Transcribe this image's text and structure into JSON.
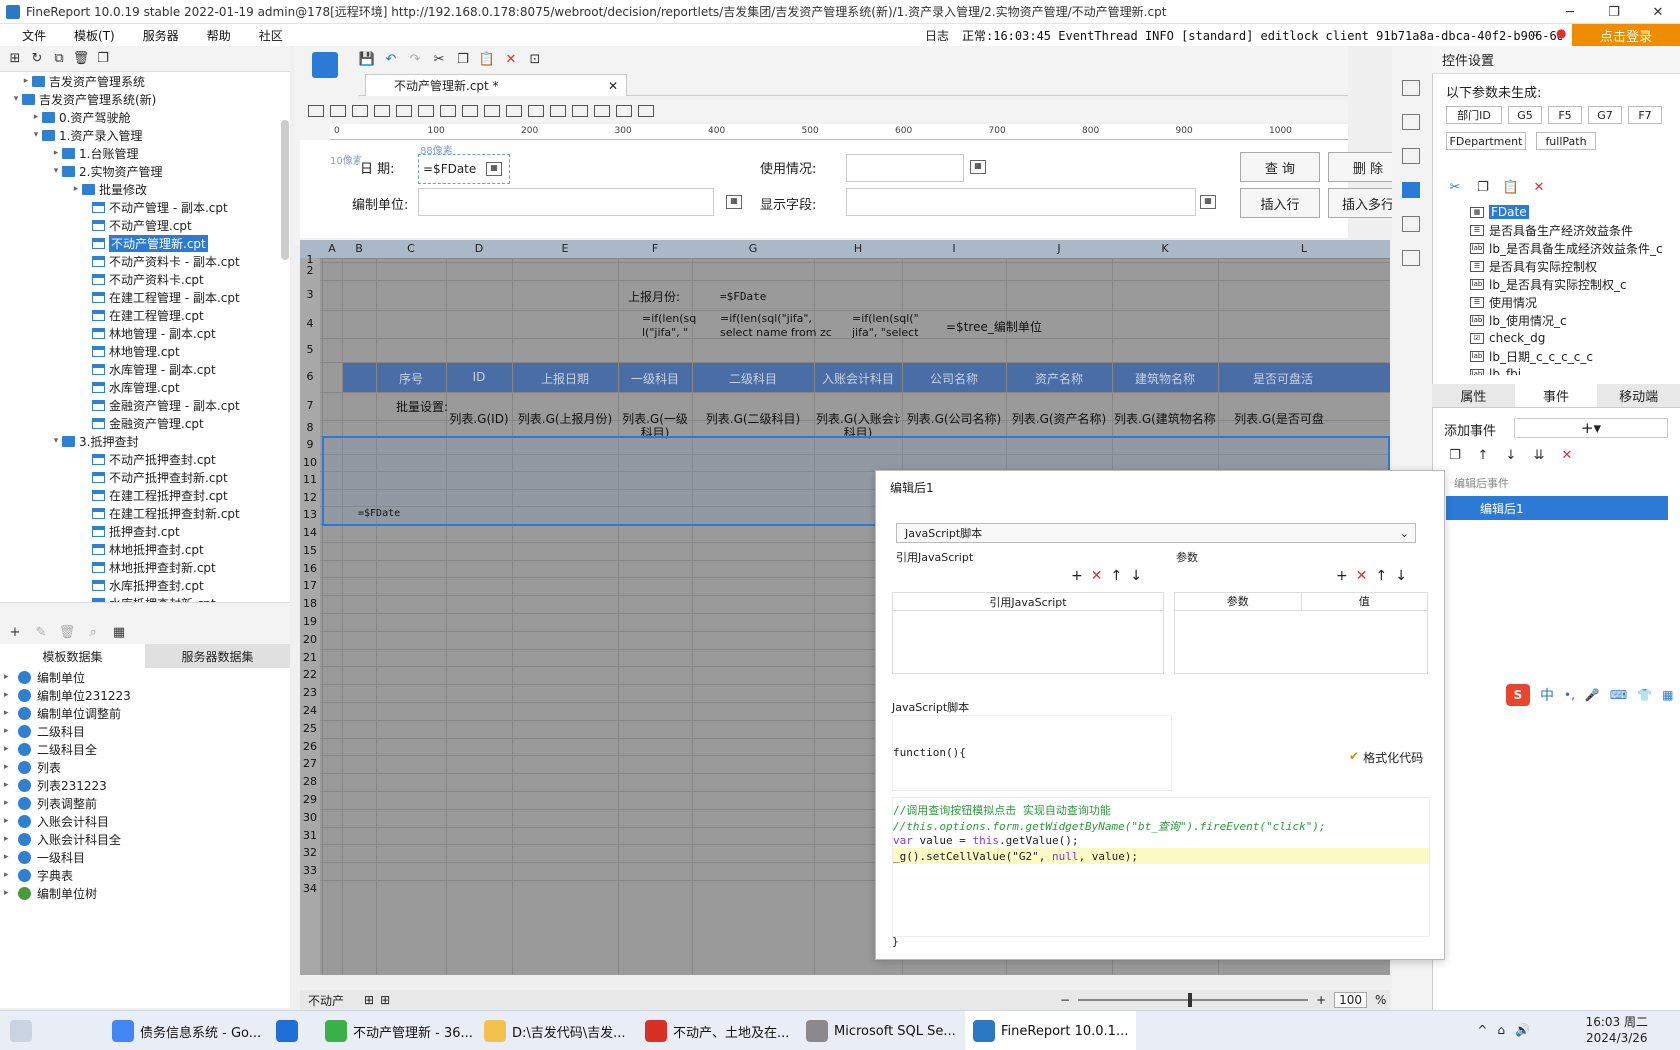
{
  "window": {
    "title": "FineReport 10.0.19 stable 2022-01-19 admin@178[远程环境]   http://192.168.0.178:8075/webroot/decision/reportlets/吉发集团/吉发资产管理系统(新)/1.资产录入管理/2.实物资产管理/不动产管理新.cpt",
    "controls": [
      "─",
      "❐",
      "✕"
    ]
  },
  "menu": {
    "items": [
      "文件",
      "模板(T)",
      "服务器",
      "帮助",
      "社区"
    ],
    "log_label": "日志",
    "log_text": "正常:16:03:45 EventThread INFO [standard] editlock client 91b71a8a-dbca-40f2-b906-68f6f8b4...",
    "login": "点击登录"
  },
  "tree": {
    "rows": [
      {
        "text": "吉发资产管理系统",
        "indent": 2,
        "type": "folder",
        "toggle": "▸"
      },
      {
        "text": "吉发资产管理系统(新)",
        "indent": 1,
        "type": "folder",
        "toggle": "▾"
      },
      {
        "text": "0.资产驾驶舱",
        "indent": 3,
        "type": "folder",
        "toggle": "▸"
      },
      {
        "text": "1.资产录入管理",
        "indent": 3,
        "type": "folder",
        "toggle": "▾"
      },
      {
        "text": "1.台账管理",
        "indent": 5,
        "type": "folder",
        "toggle": "▸"
      },
      {
        "text": "2.实物资产管理",
        "indent": 5,
        "type": "folder",
        "toggle": "▾"
      },
      {
        "text": "批量修改",
        "indent": 7,
        "type": "folder",
        "toggle": "▸"
      },
      {
        "text": "不动产管理 - 副本.cpt",
        "indent": 8,
        "type": "file",
        "toggle": ""
      },
      {
        "text": "不动产管理.cpt",
        "indent": 8,
        "type": "file",
        "toggle": ""
      },
      {
        "text": "不动产管理新.cpt",
        "indent": 8,
        "type": "file",
        "toggle": "",
        "selected": true
      },
      {
        "text": "不动产资料卡 - 副本.cpt",
        "indent": 8,
        "type": "file",
        "toggle": ""
      },
      {
        "text": "不动产资料卡.cpt",
        "indent": 8,
        "type": "file",
        "toggle": ""
      },
      {
        "text": "在建工程管理 - 副本.cpt",
        "indent": 8,
        "type": "file",
        "toggle": ""
      },
      {
        "text": "在建工程管理.cpt",
        "indent": 8,
        "type": "file",
        "toggle": ""
      },
      {
        "text": "林地管理 - 副本.cpt",
        "indent": 8,
        "type": "file",
        "toggle": ""
      },
      {
        "text": "林地管理.cpt",
        "indent": 8,
        "type": "file",
        "toggle": ""
      },
      {
        "text": "水库管理 - 副本.cpt",
        "indent": 8,
        "type": "file",
        "toggle": ""
      },
      {
        "text": "水库管理.cpt",
        "indent": 8,
        "type": "file",
        "toggle": ""
      },
      {
        "text": "金融资产管理 - 副本.cpt",
        "indent": 8,
        "type": "file",
        "toggle": ""
      },
      {
        "text": "金融资产管理.cpt",
        "indent": 8,
        "type": "file",
        "toggle": ""
      },
      {
        "text": "3.抵押查封",
        "indent": 5,
        "type": "folder",
        "toggle": "▾"
      },
      {
        "text": "不动产抵押查封.cpt",
        "indent": 8,
        "type": "file",
        "toggle": ""
      },
      {
        "text": "不动产抵押查封新.cpt",
        "indent": 8,
        "type": "file",
        "toggle": ""
      },
      {
        "text": "在建工程抵押查封.cpt",
        "indent": 8,
        "type": "file",
        "toggle": ""
      },
      {
        "text": "在建工程抵押查封新.cpt",
        "indent": 8,
        "type": "file",
        "toggle": ""
      },
      {
        "text": "抵押查封.cpt",
        "indent": 8,
        "type": "file",
        "toggle": ""
      },
      {
        "text": "林地抵押查封.cpt",
        "indent": 8,
        "type": "file",
        "toggle": ""
      },
      {
        "text": "林地抵押查封新.cpt",
        "indent": 8,
        "type": "file",
        "toggle": ""
      },
      {
        "text": "水库抵押查封.cpt",
        "indent": 8,
        "type": "file",
        "toggle": ""
      },
      {
        "text": "水库抵押查封新.cpt",
        "indent": 8,
        "type": "file",
        "toggle": ""
      }
    ]
  },
  "datasets": {
    "tab_template": "模板数据集",
    "tab_server": "服务器数据集",
    "items": [
      "编制单位",
      "编制单位231223",
      "编制单位调整前",
      "二级科目",
      "二级科目全",
      "列表",
      "列表231223",
      "列表调整前",
      "入账会计科目",
      "入账会计科目全",
      "一级科目",
      "字典表",
      "编制单位树"
    ]
  },
  "doc": {
    "tab_name": "不动产管理新.cpt *"
  },
  "ruler": [
    "0",
    "100",
    "200",
    "300",
    "400",
    "500",
    "600",
    "700",
    "800",
    "900",
    "1000"
  ],
  "params": {
    "hint_top": "88像素",
    "hint_left": "10像素",
    "date_label": "日 期:",
    "date_value": "=$FDate",
    "unit_label": "编制单位:",
    "usage_label": "使用情况:",
    "field_label": "显示字段:",
    "btn_query": "查 询",
    "btn_delete": "删 除",
    "btn_insert": "插入行",
    "btn_insert_multi": "插入多行"
  },
  "sheet": {
    "columns": [
      "A",
      "B",
      "C",
      "D",
      "E",
      "F",
      "G",
      "H",
      "I",
      "J",
      "K",
      "L"
    ],
    "rows": [
      "1",
      "2",
      "3",
      "4",
      "5",
      "6",
      "7",
      "8",
      "9",
      "10",
      "11",
      "12",
      "13",
      "14",
      "15",
      "16",
      "17",
      "18",
      "19",
      "20",
      "21",
      "22",
      "23",
      "24",
      "25",
      "26",
      "27",
      "28",
      "29",
      "30",
      "31",
      "32",
      "33",
      "34"
    ],
    "cells": {
      "f2": "上报月份:",
      "g2": "=$FDate",
      "f3": "=if(len(sq\nl(\"jifa\", \"",
      "g3": "=if(len(sql(\"jifa\",\nselect name from zc",
      "h3": "=if(len(sql(\"\njifa\", \"select",
      "i3": "=$tree_编制单位",
      "batch": "批量设置:",
      "c10": "=$FDate"
    },
    "header_row": [
      "序号",
      "ID",
      "上报日期",
      "一级科目",
      "二级科目",
      "入账会计科目",
      "公司名称",
      "资产名称",
      "建筑物名称",
      "是否可盘活"
    ],
    "row7": [
      "列表.G(ID)",
      "列表.G(上报月份)",
      "列表.G(一级\n科目)",
      "列表.G(二级科目)",
      "列表.G(入账会计\n科目)",
      "列表.G(公司名称)",
      "列表.G(资产名称)",
      "列表.G(建筑物名称)",
      "列表.G(是否可盘"
    ],
    "sheet_tab": "不动产",
    "zoom": "100",
    "zoom_unit": "%"
  },
  "right_panel": {
    "title": "控件设置",
    "notice": "以下参数未生成:",
    "params": [
      "部门ID",
      "G5",
      "F5",
      "G7",
      "F7",
      "FDepartment",
      "fullPath"
    ],
    "widgets": [
      {
        "name": "FDate",
        "icon": "cal",
        "selected": true
      },
      {
        "name": "是否具备生产经济效益条件",
        "icon": "combo"
      },
      {
        "name": "lb_是否具备生成经济效益条件_c",
        "icon": "lab"
      },
      {
        "name": "是否具有实际控制权",
        "icon": "combo"
      },
      {
        "name": "lb_是否具有实际控制权_c",
        "icon": "lab"
      },
      {
        "name": "使用情况",
        "icon": "combo"
      },
      {
        "name": "lb_使用情况_c",
        "icon": "lab"
      },
      {
        "name": "check_dg",
        "icon": "chk"
      },
      {
        "name": "lb_日期_c_c_c_c_c",
        "icon": "lab"
      },
      {
        "name": "lb_fbi...",
        "icon": "lab"
      }
    ],
    "tabs": [
      "属性",
      "事件",
      "移动端"
    ],
    "add_event": "添加事件",
    "event_section": "编辑后事件",
    "event_item": "编辑后1"
  },
  "dialog": {
    "title": "编辑后1",
    "type": "JavaScript脚本",
    "ref_js": "引用JavaScript",
    "params_label": "参数",
    "ref_js_col": "引用JavaScript",
    "param_col": "参数",
    "value_col": "值",
    "script_label": "JavaScript脚本",
    "fn_head": "function(){",
    "format_btn": "格式化代码",
    "code_line1": "//调用查询按钮模拟点击 实现自动查询功能",
    "code_line2": "//this.options.form.getWidgetByName(\"bt_查询\").fireEvent(\"click\");",
    "code_line3a": "var",
    "code_line3b": " value = ",
    "code_line3c": "this",
    "code_line3d": ".getValue();",
    "code_line4a": "_g().setCellValue(\"G2\", ",
    "code_line4b": "null",
    "code_line4c": ", value);",
    "fn_tail": "}"
  },
  "ime": {
    "label": "中"
  },
  "taskbar": {
    "items": [
      {
        "label": "债务信息系统 - Go...",
        "color": "#4285f4"
      },
      {
        "label": "",
        "color": "#1e6fd9"
      },
      {
        "label": "不动产管理新 - 36...",
        "color": "#3bb14a"
      },
      {
        "label": "D:\\吉发代码\\吉发...",
        "color": "#f2c14e"
      },
      {
        "label": "不动产、土地及在...",
        "color": "#d93025"
      },
      {
        "label": "Microsoft SQL Se...",
        "color": "#8a8a8a"
      },
      {
        "label": "FineReport 10.0.1...",
        "color": "#2b78c5"
      }
    ],
    "time": "16:03 周二",
    "date": "2024/3/26"
  },
  "colors": {
    "accent": "#2b7bd6",
    "header_band": "#4a6da6",
    "login": "#f08c00"
  }
}
